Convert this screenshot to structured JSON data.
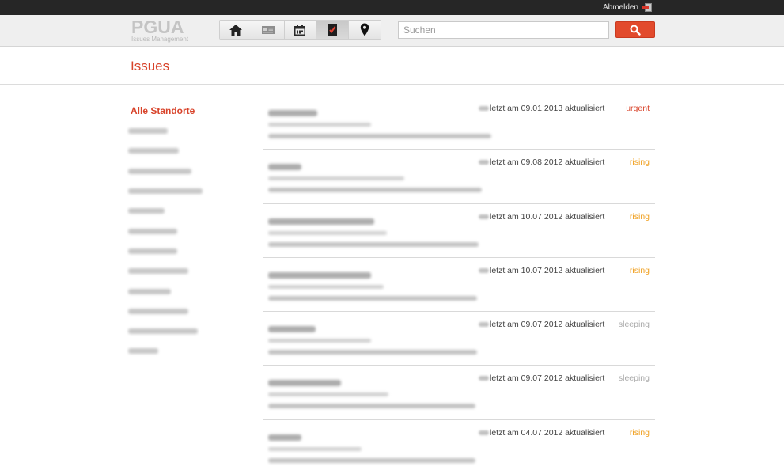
{
  "topbar": {
    "logout_label": "Abmelden",
    "logout_icon": "logout-icon"
  },
  "header": {
    "logo_title": "PGUA",
    "logo_subtitle": "Issues Management",
    "nav": [
      {
        "icon": "home-icon",
        "active": false
      },
      {
        "icon": "newspaper-icon",
        "active": false
      },
      {
        "icon": "calendar-icon",
        "active": false
      },
      {
        "icon": "issues-document-icon",
        "active": true
      },
      {
        "icon": "location-pin-icon",
        "active": false
      }
    ],
    "search_placeholder": "Suchen",
    "search_icon": "search-icon"
  },
  "page": {
    "title": "Issues"
  },
  "sidebar": {
    "active_label": "Alle Standorte",
    "items_count_note": "12 blurred location entries"
  },
  "colors": {
    "accent": "#d8432a",
    "urgent": "#d8432a",
    "rising": "#f0a020",
    "sleeping": "#aaaaaa"
  },
  "issues": [
    {
      "updated": "letzt am 09.01.2013 aktualisiert",
      "status": "urgent",
      "status_color": "#d8432a"
    },
    {
      "updated": "letzt am 09.08.2012 aktualisiert",
      "status": "rising",
      "status_color": "#f0a020"
    },
    {
      "updated": "letzt am 10.07.2012 aktualisiert",
      "status": "rising",
      "status_color": "#f0a020"
    },
    {
      "updated": "letzt am 10.07.2012 aktualisiert",
      "status": "rising",
      "status_color": "#f0a020"
    },
    {
      "updated": "letzt am 09.07.2012 aktualisiert",
      "status": "sleeping",
      "status_color": "#aaaaaa"
    },
    {
      "updated": "letzt am 09.07.2012 aktualisiert",
      "status": "sleeping",
      "status_color": "#aaaaaa"
    },
    {
      "updated": "letzt am 04.07.2012 aktualisiert",
      "status": "rising",
      "status_color": "#f0a020"
    }
  ]
}
